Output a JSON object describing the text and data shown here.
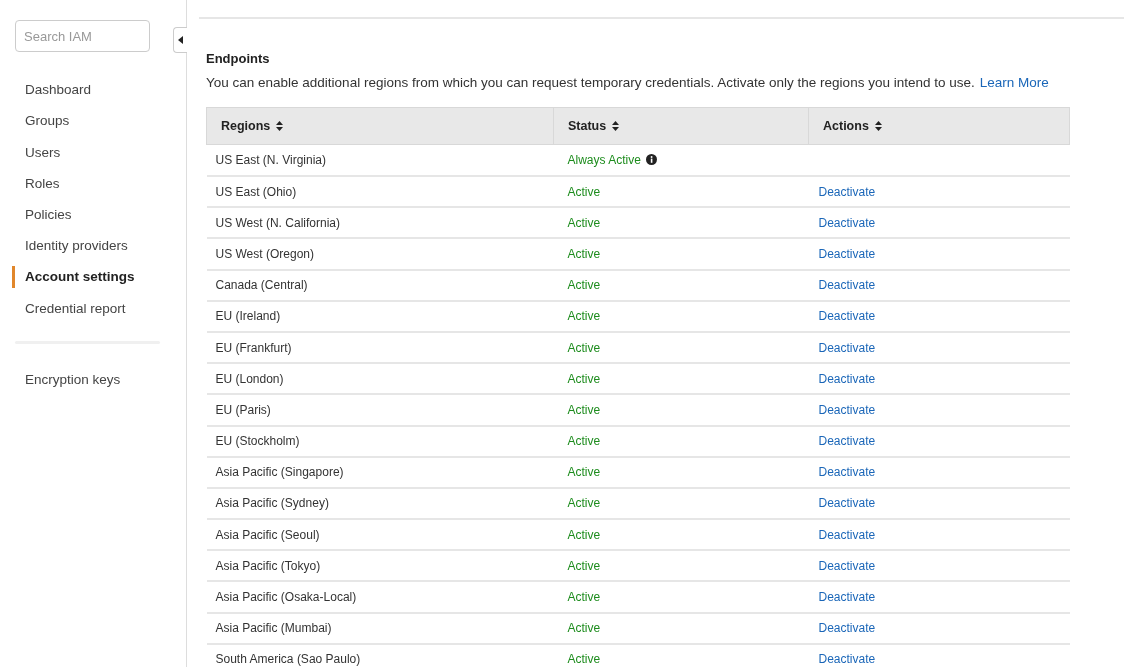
{
  "sidebar": {
    "search": {
      "placeholder": "Search IAM"
    },
    "items": [
      {
        "label": "Dashboard",
        "selected": false
      },
      {
        "label": "Groups",
        "selected": false
      },
      {
        "label": "Users",
        "selected": false
      },
      {
        "label": "Roles",
        "selected": false
      },
      {
        "label": "Policies",
        "selected": false
      },
      {
        "label": "Identity providers",
        "selected": false
      },
      {
        "label": "Account settings",
        "selected": true
      },
      {
        "label": "Credential report",
        "selected": false
      }
    ],
    "footer_items": [
      {
        "label": "Encryption keys",
        "selected": false
      }
    ]
  },
  "endpoints": {
    "title": "Endpoints",
    "description": "You can enable additional regions from which you can request temporary credentials. Activate only the regions you intend to use.",
    "link": "Learn More",
    "table": {
      "columns": [
        "Regions",
        "Status",
        "Actions"
      ],
      "rows": [
        {
          "region": "US East (N. Virginia)",
          "status": "Always Active",
          "kind": "always"
        },
        {
          "region": "US East (Ohio)",
          "status": "Active",
          "kind": "active",
          "action": "Deactivate"
        },
        {
          "region": "US West (N. California)",
          "status": "Active",
          "kind": "active",
          "action": "Deactivate"
        },
        {
          "region": "US West (Oregon)",
          "status": "Active",
          "kind": "active",
          "action": "Deactivate"
        },
        {
          "region": "Canada (Central)",
          "status": "Active",
          "kind": "active",
          "action": "Deactivate"
        },
        {
          "region": "EU (Ireland)",
          "status": "Active",
          "kind": "active",
          "action": "Deactivate"
        },
        {
          "region": "EU (Frankfurt)",
          "status": "Active",
          "kind": "active",
          "action": "Deactivate"
        },
        {
          "region": "EU (London)",
          "status": "Active",
          "kind": "active",
          "action": "Deactivate"
        },
        {
          "region": "EU (Paris)",
          "status": "Active",
          "kind": "active",
          "action": "Deactivate"
        },
        {
          "region": "EU (Stockholm)",
          "status": "Active",
          "kind": "active",
          "action": "Deactivate"
        },
        {
          "region": "Asia Pacific (Singapore)",
          "status": "Active",
          "kind": "active",
          "action": "Deactivate"
        },
        {
          "region": "Asia Pacific (Sydney)",
          "status": "Active",
          "kind": "active",
          "action": "Deactivate"
        },
        {
          "region": "Asia Pacific (Seoul)",
          "status": "Active",
          "kind": "active",
          "action": "Deactivate"
        },
        {
          "region": "Asia Pacific (Tokyo)",
          "status": "Active",
          "kind": "active",
          "action": "Deactivate"
        },
        {
          "region": "Asia Pacific (Osaka-Local)",
          "status": "Active",
          "kind": "active",
          "action": "Deactivate"
        },
        {
          "region": "Asia Pacific (Mumbai)",
          "status": "Active",
          "kind": "active",
          "action": "Deactivate"
        },
        {
          "region": "South America (Sao Paulo)",
          "status": "Active",
          "kind": "active",
          "action": "Deactivate"
        }
      ]
    }
  }
}
